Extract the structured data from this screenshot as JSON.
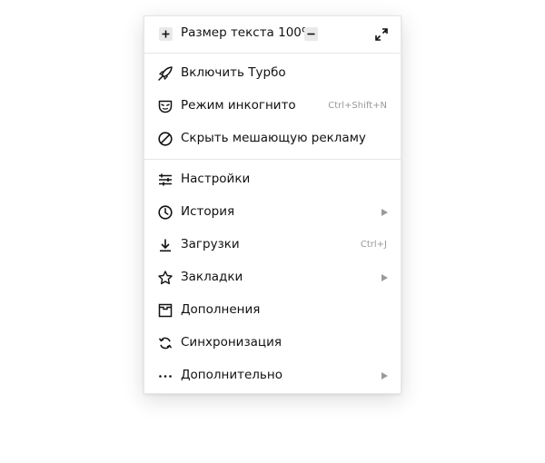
{
  "zoom": {
    "label": "Размер текста 100%",
    "increase_icon": "plus-icon",
    "decrease_icon": "minus-icon",
    "fullscreen_icon": "fullscreen-icon"
  },
  "items": [
    {
      "label": "Включить Турбо",
      "icon": "rocket-icon"
    },
    {
      "label": "Режим инкогнито",
      "icon": "incognito-mask-icon",
      "shortcut": "Ctrl+Shift+N"
    },
    {
      "label": "Скрыть мешающую рекламу",
      "icon": "block-icon"
    },
    {
      "label": "Настройки",
      "icon": "sliders-icon"
    },
    {
      "label": "История",
      "icon": "clock-icon",
      "submenu": true
    },
    {
      "label": "Загрузки",
      "icon": "download-icon",
      "shortcut": "Ctrl+J"
    },
    {
      "label": "Закладки",
      "icon": "star-icon",
      "submenu": true
    },
    {
      "label": "Дополнения",
      "icon": "extensions-icon"
    },
    {
      "label": "Синхронизация",
      "icon": "sync-icon"
    },
    {
      "label": "Дополнительно",
      "icon": "more-dots-icon",
      "submenu": true
    }
  ],
  "colors": {
    "text": "#111111",
    "muted": "#9a9a9a",
    "separator": "#e6e6e6"
  }
}
